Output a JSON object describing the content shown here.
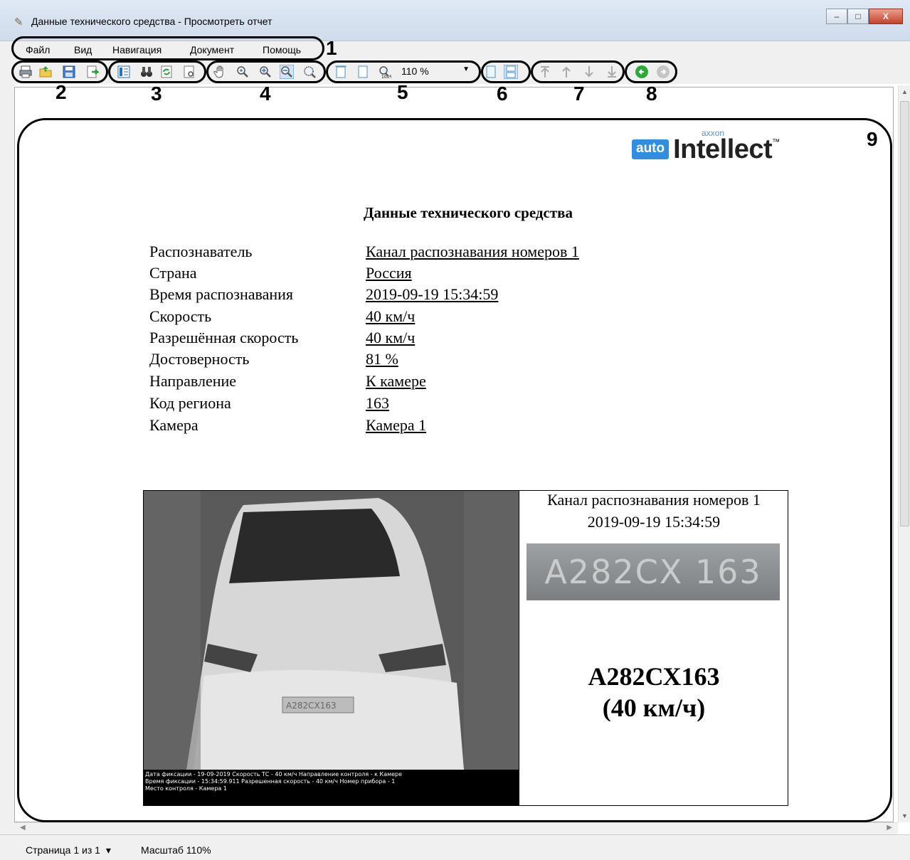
{
  "window": {
    "title": "Данные технического средства - Просмотреть отчет",
    "min": "–",
    "max": "□",
    "close": "X"
  },
  "menu": [
    "Файл",
    "Вид",
    "Навигация",
    "Документ",
    "Помощь"
  ],
  "toolbar": {
    "zoom_value": "110 %"
  },
  "callouts": [
    "1",
    "2",
    "3",
    "4",
    "5",
    "6",
    "7",
    "8",
    "9"
  ],
  "logo": {
    "badge": "auto",
    "brand": "Intellect",
    "tm": "™",
    "top": "axxon"
  },
  "report": {
    "title": "Данные технического средства",
    "fields": [
      {
        "label": "Распознаватель",
        "value": "Канал распознавания номеров 1"
      },
      {
        "label": "Страна",
        "value": "Россия"
      },
      {
        "label": "Время распознавания",
        "value": "2019-09-19 15:34:59"
      },
      {
        "label": "Скорость",
        "value": "40 км/ч"
      },
      {
        "label": "Разрешённая скорость",
        "value": "40 км/ч"
      },
      {
        "label": "Достоверность",
        "value": "81 %"
      },
      {
        "label": "Направление",
        "value": "К камере"
      },
      {
        "label": "Код региона",
        "value": "163"
      },
      {
        "label": "Камера",
        "value": "Камера 1"
      }
    ],
    "photo_caption": [
      "Дата фиксации - 19-09-2019 Скорость ТС - 40 км/ч         Направление контроля - к Камере",
      "Время фиксации - 15:34:59.911    Разрешенная скорость - 40 км/ч     Номер прибора - 1",
      "Место контроля - Камера 1"
    ],
    "photo_plate": "А282СХ163",
    "side_channel": "Канал распознавания номеров 1",
    "side_time": "2019-09-19 15:34:59",
    "plate_crop_text": "А282СХ 163",
    "plate_number": "А282СХ163",
    "plate_speed": "(40 км/ч)"
  },
  "status": {
    "page": "Страница 1 из 1",
    "page_arrow": "▾",
    "scale": "Масштаб 110%"
  }
}
